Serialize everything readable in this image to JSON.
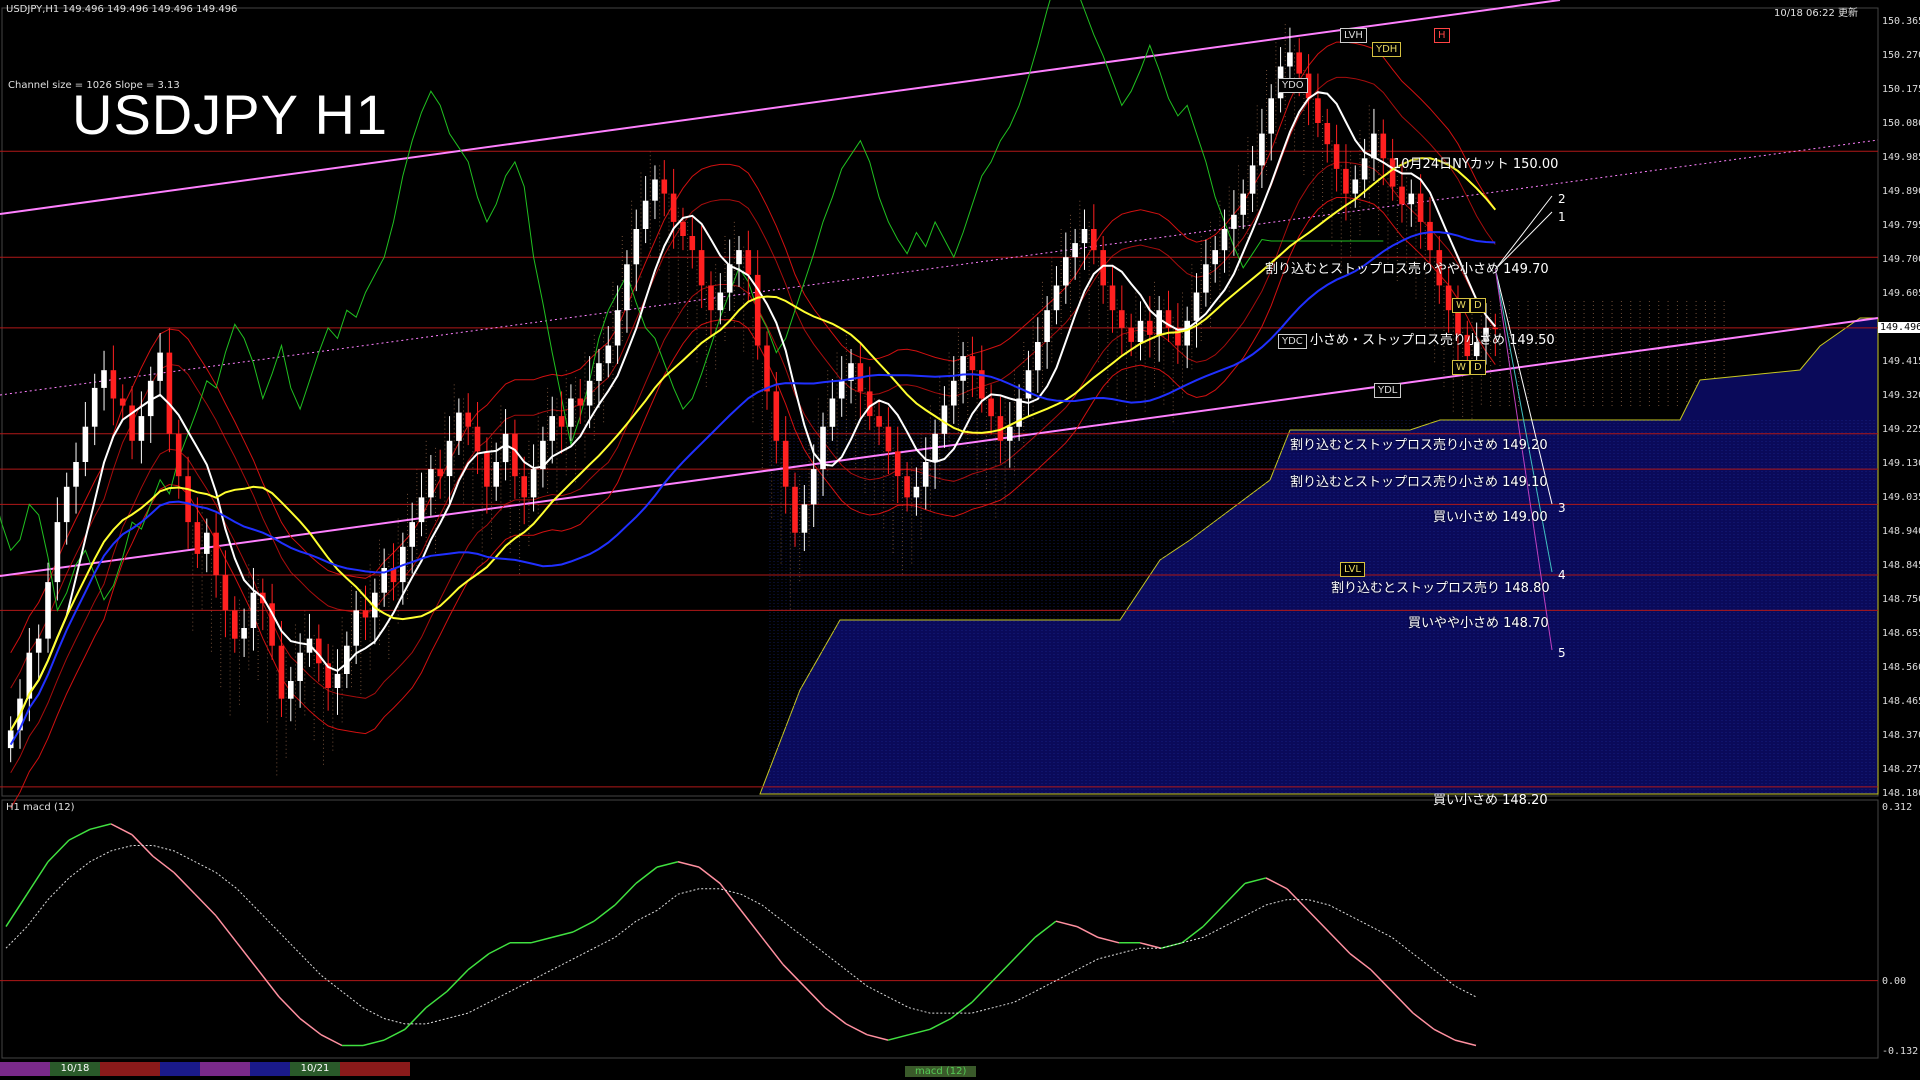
{
  "header": {
    "symbol_info": "USDJPY,H1  149.496 149.496 149.496 149.496",
    "timestamp": "10/18 06:22 更新",
    "channel_info": "Channel size = 1026 Slope = 3.13",
    "big_title": "USDJPY H1"
  },
  "macd_panel": {
    "label": "H1  macd (12)",
    "axis": [
      "0.312",
      "0.00",
      "-0.132"
    ]
  },
  "price_axis": [
    "150.365",
    "150.270",
    "150.175",
    "150.080",
    "149.985",
    "149.890",
    "149.795",
    "149.700",
    "149.605",
    "149.415",
    "149.320",
    "149.225",
    "149.130",
    "149.035",
    "148.940",
    "148.845",
    "148.750",
    "148.655",
    "148.560",
    "148.465",
    "148.370",
    "148.275",
    "148.180"
  ],
  "current_price": "149.496",
  "levels": [
    {
      "price": 150.0,
      "label": "10月24日NYカット 150.00"
    },
    {
      "price": 149.7,
      "label": "割り込むとストップロス売りやや小さめ 149.70"
    },
    {
      "price": 149.5,
      "label": "小さめ・ストップロス売り小さめ 149.50"
    },
    {
      "price": 149.2,
      "label": "割り込むとストップロス売り小さめ 149.20"
    },
    {
      "price": 149.1,
      "label": "割り込むとストップロス売り小さめ 149.10"
    },
    {
      "price": 149.0,
      "label": "買い小さめ 149.00"
    },
    {
      "price": 148.8,
      "label": "割り込むとストップロス売り 148.80"
    },
    {
      "price": 148.7,
      "label": "買いやや小さめ 148.70"
    },
    {
      "price": 148.2,
      "label": "買い小さめ 148.20"
    }
  ],
  "markers": [
    "1",
    "2",
    "3",
    "4",
    "5"
  ],
  "boxes": [
    "LVH",
    "YDH",
    "YDO",
    "YDC",
    "YDL",
    "LVL",
    "W",
    "D",
    "W",
    "D",
    "H"
  ],
  "bottom_bar": {
    "date1": "10/18",
    "date2": "10/21",
    "tab": "macd (12)"
  },
  "colors": {
    "candle_up": "#ffffff",
    "candle_down": "#ff2020",
    "ma_white": "#ffffff",
    "ma_yellow": "#ffff30",
    "ma_blue": "#2030ff",
    "bollinger": "#d01010",
    "chikou": "#20c020",
    "channel": "#ff80ff",
    "macd_up": "#40e040",
    "macd_down": "#ff90a0"
  },
  "chart_data": [
    {
      "type": "candlestick",
      "title": "USDJPY H1",
      "ylim": [
        148.18,
        150.4
      ],
      "y_ticks": [
        150.365,
        150.27,
        150.175,
        150.08,
        149.985,
        149.89,
        149.795,
        149.7,
        149.605,
        149.415,
        149.32,
        149.225,
        149.13,
        149.035,
        148.94,
        148.845,
        148.75,
        148.655,
        148.56,
        148.465,
        148.37,
        148.275,
        148.18
      ],
      "close": [
        148.36,
        148.45,
        148.58,
        148.62,
        148.78,
        148.95,
        149.05,
        149.12,
        149.22,
        149.33,
        149.38,
        149.3,
        149.28,
        149.18,
        149.25,
        149.35,
        149.43,
        149.2,
        149.08,
        148.95,
        148.86,
        148.92,
        148.8,
        148.7,
        148.62,
        148.65,
        148.75,
        148.72,
        148.6,
        148.45,
        148.5,
        148.58,
        148.62,
        148.55,
        148.48,
        148.52,
        148.6,
        148.7,
        148.68,
        148.75,
        148.82,
        148.78,
        148.88,
        148.95,
        149.02,
        149.1,
        149.08,
        149.18,
        149.26,
        149.22,
        149.15,
        149.05,
        149.12,
        149.2,
        149.08,
        149.02,
        149.1,
        149.18,
        149.25,
        149.22,
        149.3,
        149.28,
        149.35,
        149.4,
        149.45,
        149.55,
        149.68,
        149.78,
        149.86,
        149.92,
        149.88,
        149.8,
        149.76,
        149.72,
        149.62,
        149.55,
        149.6,
        149.68,
        149.72,
        149.65,
        149.45,
        149.32,
        149.18,
        149.05,
        148.92,
        149.0,
        149.1,
        149.22,
        149.3,
        149.35,
        149.4,
        149.32,
        149.25,
        149.22,
        149.15,
        149.08,
        149.02,
        149.05,
        149.12,
        149.2,
        149.28,
        149.35,
        149.42,
        149.38,
        149.3,
        149.25,
        149.18,
        149.22,
        149.3,
        149.38,
        149.46,
        149.55,
        149.62,
        149.7,
        149.74,
        149.78,
        149.72,
        149.62,
        149.55,
        149.5,
        149.46,
        149.52,
        149.48,
        149.55,
        149.5,
        149.45,
        149.52,
        149.6,
        149.68,
        149.72,
        149.78,
        149.82,
        149.88,
        149.96,
        150.05,
        150.15,
        150.24,
        150.28,
        150.22,
        150.15,
        150.08,
        150.02,
        149.95,
        149.88,
        149.92,
        149.98,
        150.05,
        149.98,
        149.9,
        149.85,
        149.88,
        149.8,
        149.72,
        149.62,
        149.55,
        149.48,
        149.42,
        149.46,
        149.5,
        149.496
      ],
      "bands": {
        "ma_white": "MA",
        "ma_yellow": "MA",
        "ma_blue": "MA",
        "bollinger": "BB",
        "ichimoku_cloud": "cloud"
      },
      "levels": [
        150.0,
        149.7,
        149.5,
        149.2,
        149.1,
        149.0,
        148.8,
        148.7,
        148.2
      ]
    },
    {
      "type": "line",
      "title": "H1  macd (12)",
      "ylim": [
        -0.132,
        0.312
      ],
      "series": [
        {
          "values": [
            0.1,
            0.16,
            0.22,
            0.26,
            0.28,
            0.29,
            0.27,
            0.23,
            0.2,
            0.16,
            0.12,
            0.07,
            0.02,
            -0.03,
            -0.07,
            -0.1,
            -0.12,
            -0.12,
            -0.11,
            -0.09,
            -0.05,
            -0.02,
            0.02,
            0.05,
            0.07,
            0.07,
            0.08,
            0.09,
            0.11,
            0.14,
            0.18,
            0.21,
            0.22,
            0.21,
            0.18,
            0.13,
            0.08,
            0.03,
            -0.01,
            -0.05,
            -0.08,
            -0.1,
            -0.11,
            -0.1,
            -0.09,
            -0.07,
            -0.04,
            0.0,
            0.04,
            0.08,
            0.11,
            0.1,
            0.08,
            0.07,
            0.07,
            0.06,
            0.07,
            0.1,
            0.14,
            0.18,
            0.19,
            0.17,
            0.13,
            0.09,
            0.05,
            0.02,
            -0.02,
            -0.06,
            -0.09,
            -0.11,
            -0.12
          ]
        },
        {
          "values": [
            0.06,
            0.1,
            0.15,
            0.19,
            0.22,
            0.24,
            0.25,
            0.25,
            0.24,
            0.22,
            0.2,
            0.17,
            0.13,
            0.09,
            0.05,
            0.01,
            -0.02,
            -0.05,
            -0.07,
            -0.08,
            -0.08,
            -0.07,
            -0.06,
            -0.04,
            -0.02,
            0.0,
            0.02,
            0.04,
            0.06,
            0.08,
            0.11,
            0.13,
            0.16,
            0.17,
            0.17,
            0.16,
            0.14,
            0.11,
            0.08,
            0.05,
            0.02,
            -0.01,
            -0.03,
            -0.05,
            -0.06,
            -0.06,
            -0.06,
            -0.05,
            -0.04,
            -0.02,
            0.0,
            0.02,
            0.04,
            0.05,
            0.06,
            0.06,
            0.07,
            0.08,
            0.1,
            0.12,
            0.14,
            0.15,
            0.15,
            0.14,
            0.12,
            0.1,
            0.08,
            0.05,
            0.02,
            -0.01,
            -0.03
          ]
        }
      ]
    }
  ]
}
